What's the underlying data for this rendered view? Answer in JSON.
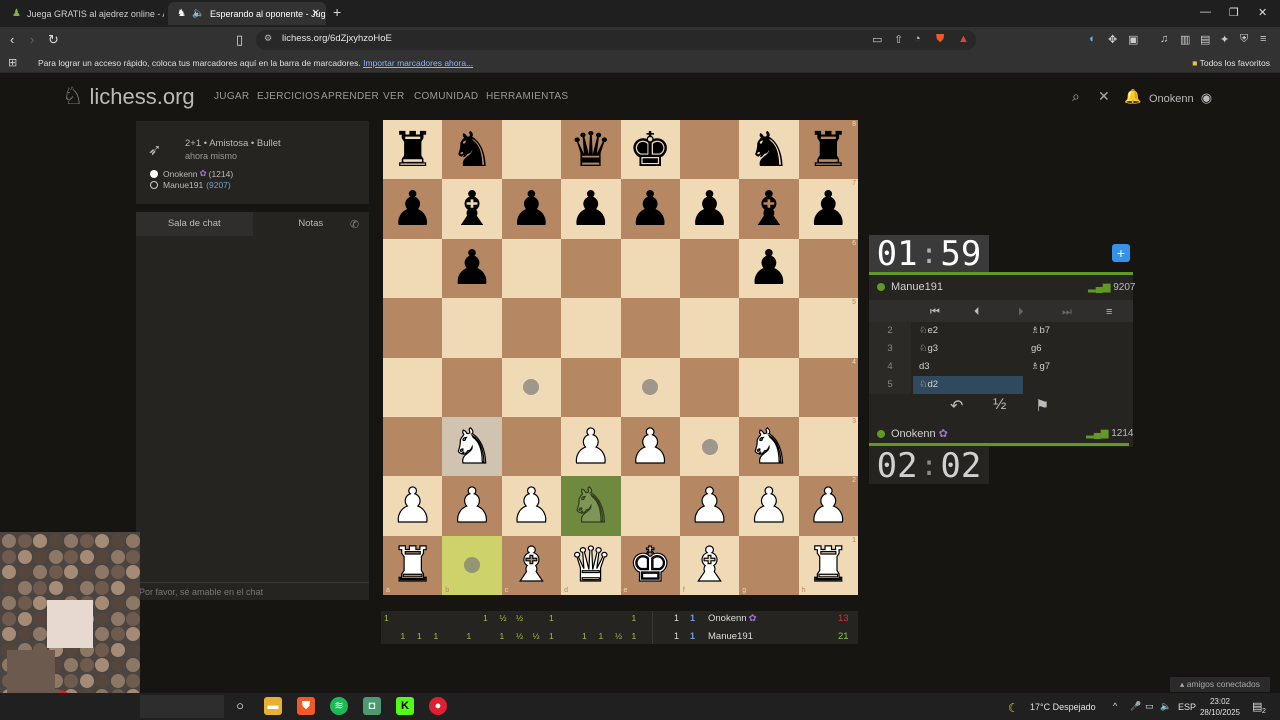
{
  "browser": {
    "tabs": [
      {
        "title": "Juega GRATIS al ajedrez online - Aje",
        "active": false
      },
      {
        "title": "Esperando al oponente - Jug",
        "active": true
      }
    ],
    "url": "lichess.org/6dZjxyhzoHoE",
    "bookmarks_hint": "Para lograr un acceso rápido, coloca tus marcadores aquí en la barra de marcadores.",
    "import_link": "Importar marcadores ahora...",
    "all_favorites": "Todos los favoritos"
  },
  "site": {
    "logo": "lichess.org",
    "nav": [
      "JUGAR",
      "EJERCICIOS",
      "APRENDER",
      "VER",
      "COMUNIDAD",
      "HERRAMIENTAS"
    ],
    "user": "Onokenn"
  },
  "game": {
    "type": "2+1 • Amistosa • Bullet",
    "time": "ahora mismo",
    "white_player": "Onokenn",
    "white_rating": "(1214)",
    "black_player": "Manue191",
    "black_rating": "(9207)"
  },
  "chat": {
    "tab_chat": "Sala de chat",
    "tab_notes": "Notas",
    "placeholder": "Por favor, sé amable en el chat"
  },
  "board": {
    "ranks": [
      "8",
      "7",
      "6",
      "5",
      "4",
      "3",
      "2",
      "1"
    ],
    "files": [
      "a",
      "b",
      "c",
      "d",
      "e",
      "f",
      "g",
      "h"
    ],
    "position": [
      [
        "bR",
        "bN",
        "",
        "bQ",
        "bK",
        "",
        "bN",
        "bR"
      ],
      [
        "bP",
        "bB",
        "bP",
        "bP",
        "bP",
        "bP",
        "bB",
        "bP"
      ],
      [
        "",
        "bP",
        "",
        "",
        "",
        "",
        "bP",
        ""
      ],
      [
        "",
        "",
        "",
        "",
        "",
        "",
        "",
        ""
      ],
      [
        "",
        "",
        "dot",
        "",
        "dot",
        "",
        "",
        ""
      ],
      [
        "",
        "wN",
        "",
        "wP",
        "wP",
        "dot",
        "wN",
        ""
      ],
      [
        "wP",
        "wP",
        "wP",
        "ghostN",
        "",
        "wP",
        "wP",
        "wP"
      ],
      [
        "wR",
        "dot",
        "wB",
        "wQ",
        "wK",
        "wB",
        "",
        "wR"
      ]
    ]
  },
  "clocks": {
    "top_min": "01",
    "top_sec": "59",
    "bottom_min": "02",
    "bottom_sec": "02"
  },
  "opponent": {
    "name": "Manue191",
    "rating": "9207"
  },
  "me": {
    "name": "Onokenn",
    "rating": "1214"
  },
  "moves": [
    {
      "n": "2",
      "w": "♘e2",
      "b": "♗b7"
    },
    {
      "n": "3",
      "w": "♘g3",
      "b": "g6"
    },
    {
      "n": "4",
      "w": "d3",
      "b": "♗g7"
    },
    {
      "n": "5",
      "w": "♘d2",
      "b": ""
    }
  ],
  "actions": {
    "takeback": "↶",
    "draw": "½",
    "resign": "⚑"
  },
  "scoreboard": {
    "row1_name": "Onokenn",
    "row1_score": "13",
    "row2_name": "Manue191",
    "row2_score": "21",
    "row1_cells": [
      "1",
      "",
      "",
      "",
      "",
      "",
      "1",
      "½",
      "½",
      "",
      "1",
      "",
      "",
      "",
      "",
      "1"
    ],
    "row2_cells": [
      "",
      "1",
      "1",
      "1",
      "",
      "1",
      "",
      "1",
      "½",
      "½",
      "1",
      "",
      "1",
      "1",
      "½",
      "1"
    ]
  },
  "taskbar": {
    "weather": "17°C Despejado",
    "lang": "ESP",
    "time": "23:02",
    "date": "28/10/2025",
    "friends": "amigos conectados",
    "notif_count": "2"
  },
  "colors": {
    "board_light": "#f0d9b5",
    "board_dark": "#b58863",
    "accent_green": "#629924",
    "blue": "#3692e7"
  }
}
